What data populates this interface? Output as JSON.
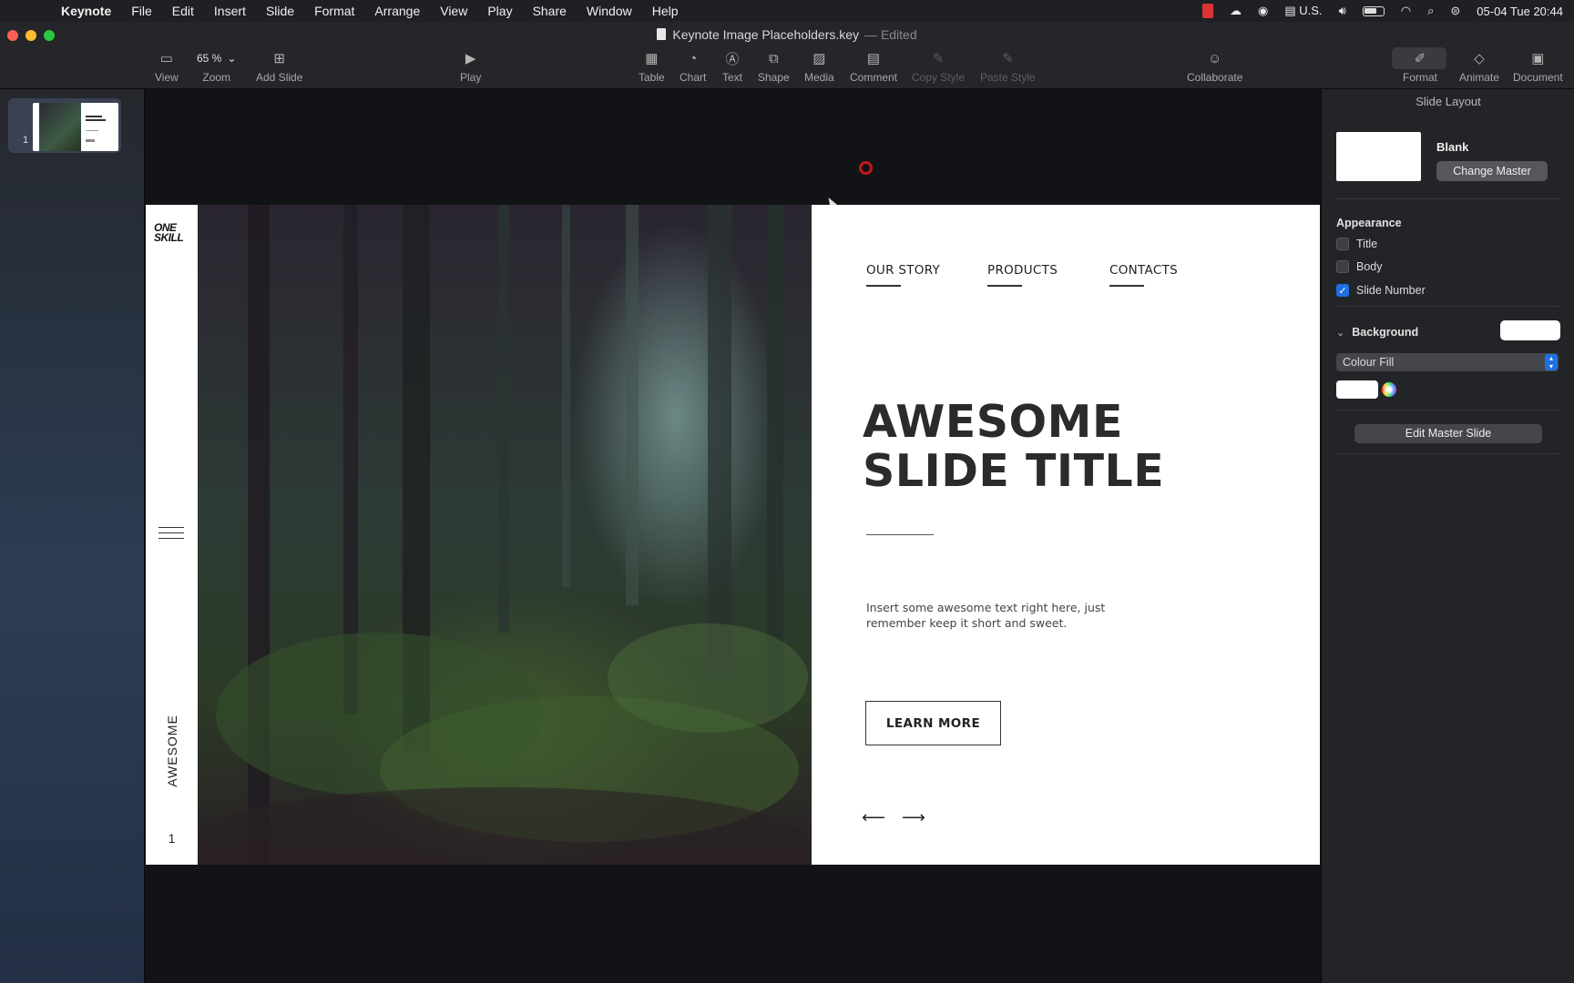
{
  "menubar": {
    "items": [
      "Keynote",
      "File",
      "Edit",
      "Insert",
      "Slide",
      "Format",
      "Arrange",
      "View",
      "Play",
      "Share",
      "Window",
      "Help"
    ],
    "input_source": "U.S.",
    "clock": "05-04 Tue  20:44"
  },
  "window": {
    "doc_title": "Keynote Image Placeholders.key",
    "doc_status": "Edited"
  },
  "toolbar": {
    "view": "View",
    "zoom_value": "65 %",
    "zoom": "Zoom",
    "add_slide": "Add Slide",
    "play": "Play",
    "table": "Table",
    "chart": "Chart",
    "text": "Text",
    "shape": "Shape",
    "media": "Media",
    "comment": "Comment",
    "copy_style": "Copy Style",
    "paste_style": "Paste Style",
    "collaborate": "Collaborate",
    "format": "Format",
    "animate": "Animate",
    "document": "Document"
  },
  "navigator": {
    "slides": [
      {
        "number": "1"
      }
    ]
  },
  "slide": {
    "logo_line1": "ONE",
    "logo_line2": "SKILL",
    "vertical_word": "AWESOME",
    "page_number": "1",
    "nav": [
      "OUR STORY",
      "PRODUCTS",
      "CONTACTS"
    ],
    "headline_line1": "AWESOME",
    "headline_line2": "SLIDE TITLE",
    "body_line1": "Insert some awesome text right here, just",
    "body_line2": "remember keep it short and sweet.",
    "button_label": "LEARN MORE",
    "arrow_left": "⟵",
    "arrow_right": "⟶"
  },
  "inspector": {
    "title": "Slide Layout",
    "master_name": "Blank",
    "change_master": "Change Master",
    "appearance_label": "Appearance",
    "checkboxes": [
      {
        "label": "Title",
        "checked": false
      },
      {
        "label": "Body",
        "checked": false
      },
      {
        "label": "Slide Number",
        "checked": true
      }
    ],
    "background_label": "Background",
    "fill_type": "Colour Fill",
    "background_color": "#ffffff",
    "edit_master": "Edit Master Slide"
  },
  "colors": {
    "accent": "#1f6fe5",
    "recording_indicator": "#c3161c"
  }
}
